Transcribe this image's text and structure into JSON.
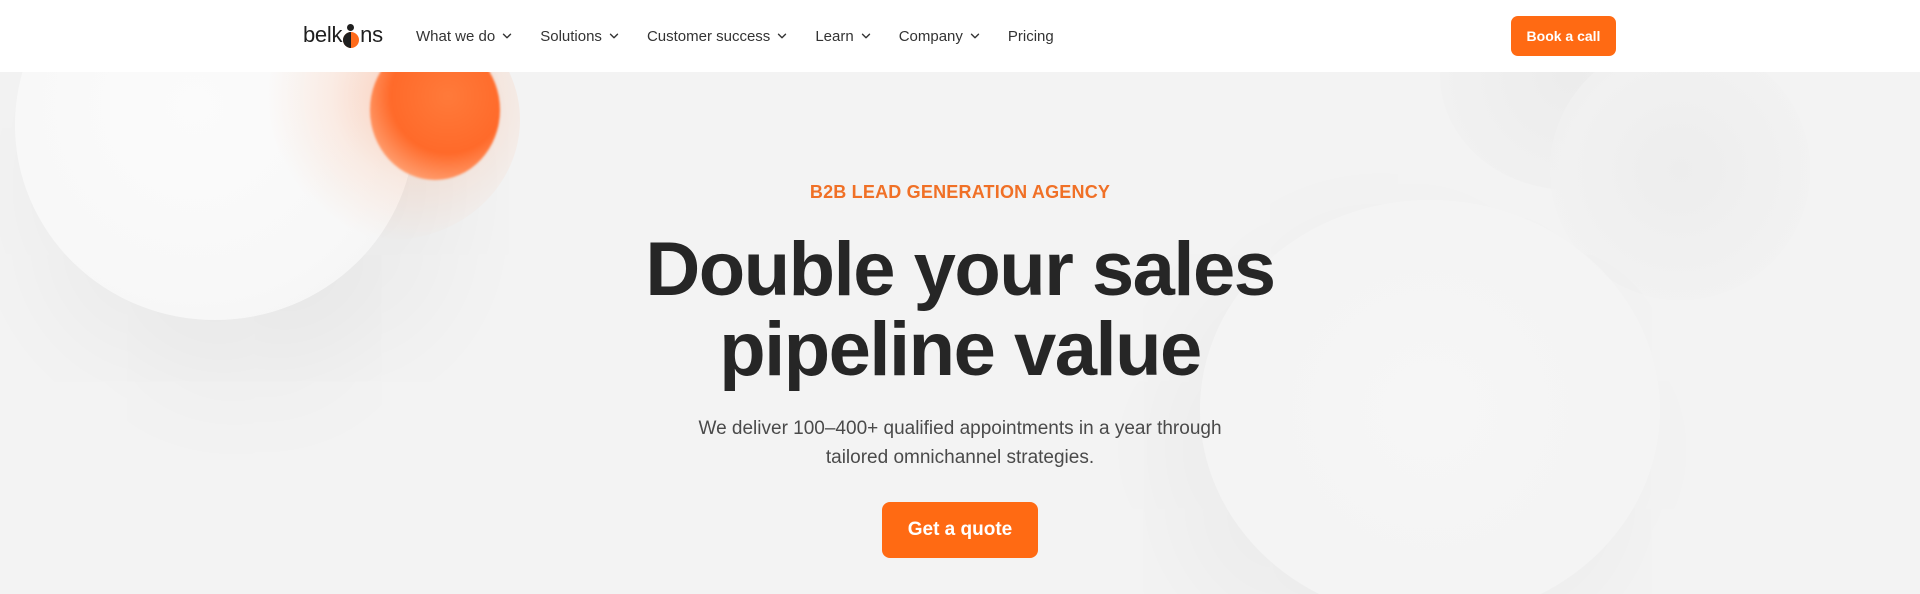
{
  "header": {
    "logo_text_left": "belk",
    "logo_text_right": "ns",
    "nav": [
      {
        "label": "What we do",
        "has_dropdown": true
      },
      {
        "label": "Solutions",
        "has_dropdown": true
      },
      {
        "label": "Customer success",
        "has_dropdown": true
      },
      {
        "label": "Learn",
        "has_dropdown": true
      },
      {
        "label": "Company",
        "has_dropdown": true
      },
      {
        "label": "Pricing",
        "has_dropdown": false
      }
    ],
    "cta_label": "Book a call"
  },
  "hero": {
    "eyebrow": "B2B LEAD GENERATION AGENCY",
    "headline_line1": "Double your sales",
    "headline_line2": "pipeline value",
    "subtext_line1": "We deliver 100–400+ qualified appointments in a year through",
    "subtext_line2": "tailored omnichannel strategies.",
    "cta_label": "Get a quote"
  },
  "colors": {
    "accent": "#ff6a13",
    "eyebrow": "#f07026",
    "text": "#262626",
    "background": "#f3f3f3"
  },
  "icons": {
    "dropdown": "chevron-down-icon"
  }
}
